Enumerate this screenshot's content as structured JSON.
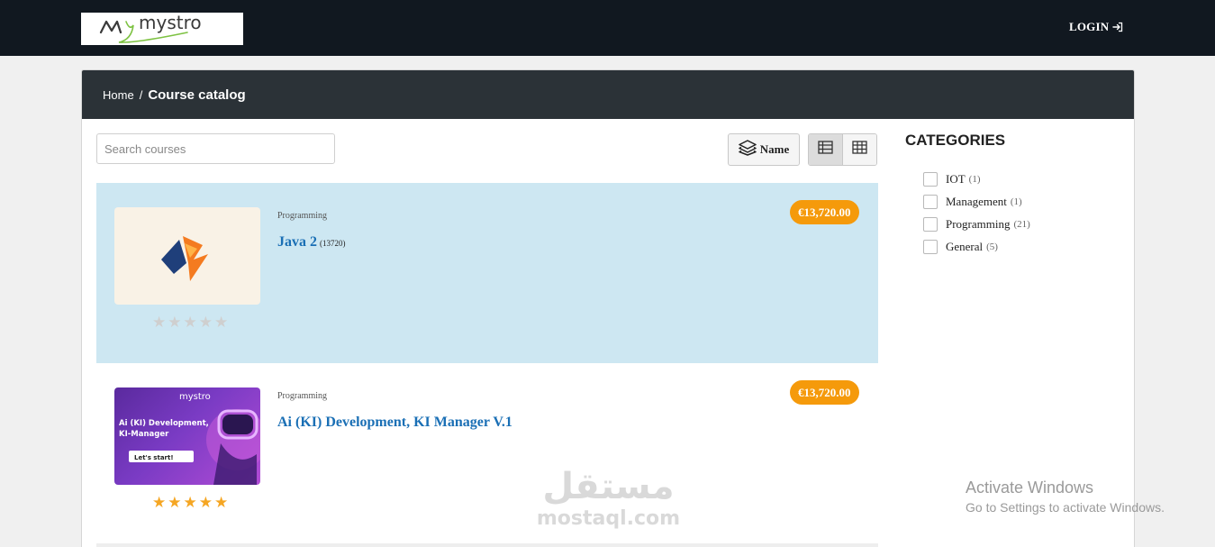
{
  "header": {
    "logo_text": "mystro",
    "login_label": "LOGIN"
  },
  "breadcrumb": {
    "home": "Home",
    "separator": "/",
    "current": "Course catalog"
  },
  "search": {
    "placeholder": "Search courses"
  },
  "toolbar": {
    "sort_label": "Name",
    "view_modes": [
      "list-view-icon",
      "grid-view-icon"
    ],
    "active_view": "list"
  },
  "courses": [
    {
      "category": "Programming",
      "title": "Java 2",
      "code": "(13720)",
      "price": "€13,720.00",
      "rating": 0,
      "highlighted": true
    },
    {
      "category": "Programming",
      "title": "Ai (KI) Development, KI Manager V.1",
      "code": "",
      "price": "€13,720.00",
      "rating": 5,
      "thumb_brand": "mystro",
      "thumb_text": "Ai (KI) Development,\nKI-Manager",
      "thumb_button": "Let's start!",
      "highlighted": false
    }
  ],
  "categories": {
    "title": "CATEGORIES",
    "items": [
      {
        "label": "IOT",
        "count": "(1)"
      },
      {
        "label": "Management",
        "count": "(1)"
      },
      {
        "label": "Programming",
        "count": "(21)"
      },
      {
        "label": "General",
        "count": "(5)"
      }
    ]
  },
  "watermark": {
    "arabic": "مستقل",
    "latin": "mostaql.com"
  },
  "os_notice": {
    "title": "Activate Windows",
    "subtitle": "Go to Settings to activate Windows."
  },
  "colors": {
    "topbar": "#111820",
    "panel_header": "#2b3237",
    "highlight_row": "#cde7f2",
    "price_badge": "#f59a0b",
    "link": "#1a6fb5",
    "star_on": "#f5a623",
    "star_off": "#cfcfcf"
  }
}
